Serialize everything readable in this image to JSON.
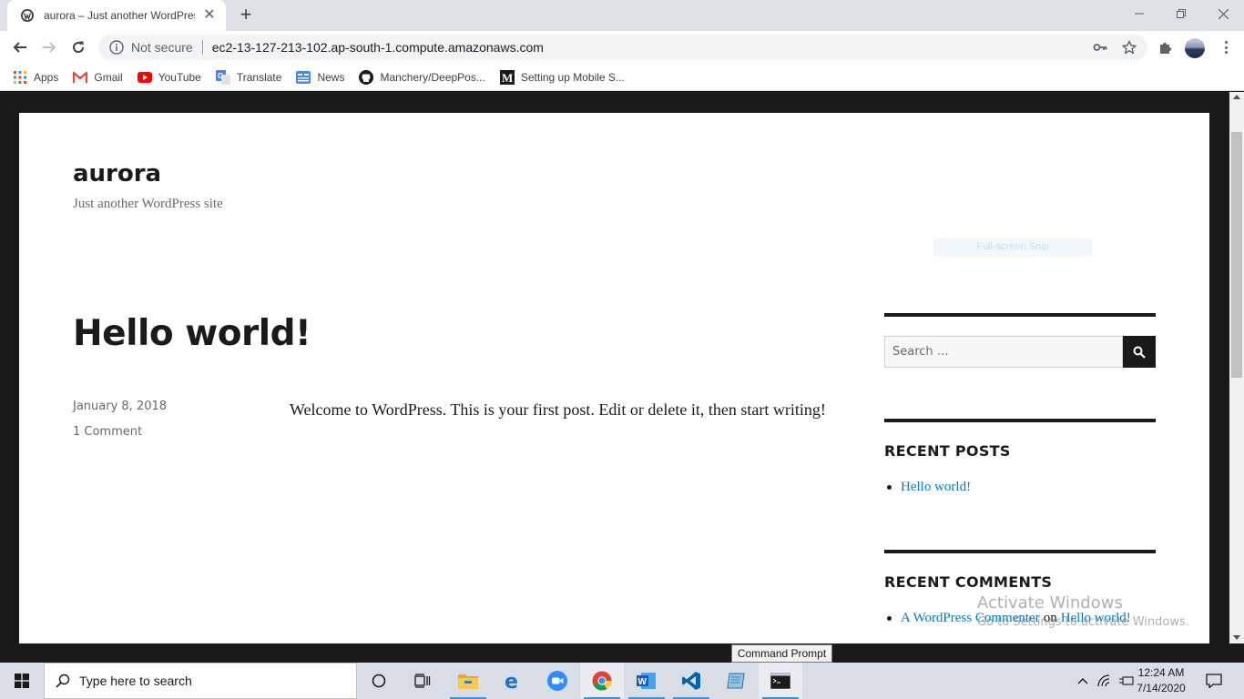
{
  "browser": {
    "tab_title": "aurora – Just another WordPress site",
    "url_security": "Not secure",
    "url": "ec2-13-127-213-102.ap-south-1.compute.amazonaws.com",
    "bookmarks": [
      {
        "label": "Apps",
        "icon": "apps-grid-icon"
      },
      {
        "label": "Gmail",
        "icon": "gmail-icon"
      },
      {
        "label": "YouTube",
        "icon": "youtube-icon"
      },
      {
        "label": "Translate",
        "icon": "translate-icon"
      },
      {
        "label": "News",
        "icon": "news-icon"
      },
      {
        "label": "Manchery/DeepPos...",
        "icon": "github-icon"
      },
      {
        "label": "Setting up Mobile S...",
        "icon": "medium-icon"
      }
    ]
  },
  "site": {
    "title": "aurora",
    "description": "Just another WordPress site"
  },
  "post": {
    "title": "Hello world!",
    "date": "January 8, 2018",
    "comments": "1 Comment",
    "body": "Welcome to WordPress. This is your first post. Edit or delete it, then start writing!"
  },
  "sidebar": {
    "search_placeholder": "Search …",
    "recent_posts_title": "RECENT POSTS",
    "recent_posts": [
      "Hello world!"
    ],
    "recent_comments_title": "RECENT COMMENTS",
    "recent_comment": {
      "author": "A WordPress Commenter",
      "on": "on",
      "post": "Hello world!"
    }
  },
  "overlay": {
    "snip": "Full-screen Snip",
    "activate_title": "Activate Windows",
    "activate_sub": "Go to Settings to activate Windows.",
    "tooltip": "Command Prompt"
  },
  "taskbar": {
    "search_placeholder": "Type here to search",
    "time": "12:24 AM",
    "date": "7/14/2020"
  },
  "colors": {
    "link": "#007acc",
    "page_frame": "#1a1a1a",
    "taskbar": "#d9dde6"
  }
}
